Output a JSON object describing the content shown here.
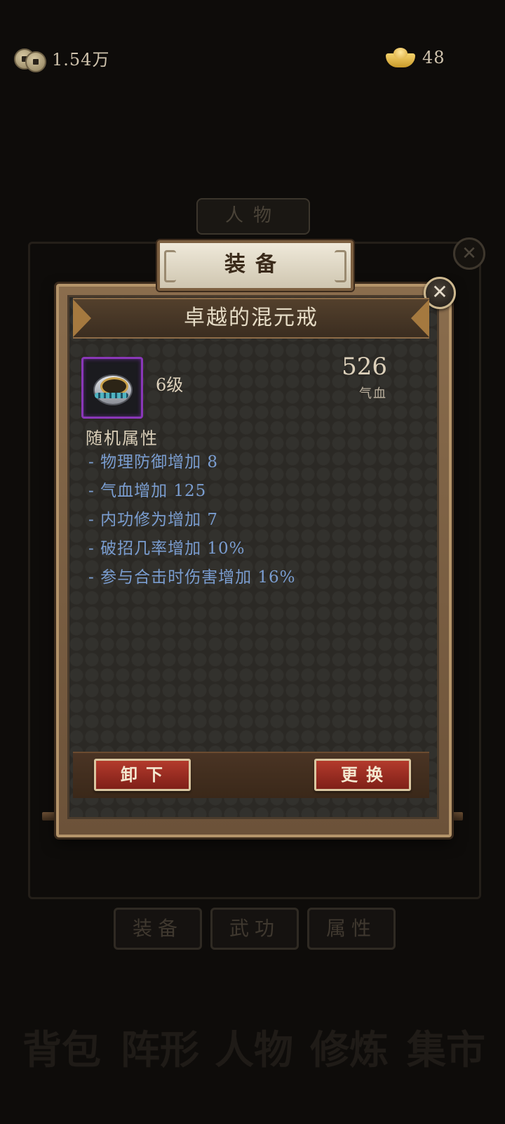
{
  "currency": {
    "copper_icon": "copper-coins-icon",
    "copper_amount": "1.54万",
    "gold_icon": "gold-ingot-icon",
    "gold_amount": "48"
  },
  "background": {
    "person_tab": "人物",
    "bottom_tabs": [
      "装备",
      "武功",
      "属性"
    ],
    "nav": [
      "背包",
      "阵形",
      "人物",
      "修炼",
      "集市"
    ]
  },
  "dialog": {
    "header_title": "装备",
    "item_name": "卓越的混元戒",
    "item_icon": "ring-icon",
    "item_rarity_color": "#8a37b8",
    "item_level": "6级",
    "main_stat_value": "526",
    "main_stat_label": "气血",
    "random_attr_title": "随机属性",
    "random_attrs": [
      "- 物理防御增加 8",
      "- 气血增加 125",
      "- 内功修为增加 7",
      "- 破招几率增加 10%",
      "- 参与合击时伤害增加 16%"
    ],
    "unequip_label": "卸下",
    "replace_label": "更换"
  },
  "colors": {
    "attr_text": "#7a9dd0",
    "button_red": "#b33a2c"
  }
}
